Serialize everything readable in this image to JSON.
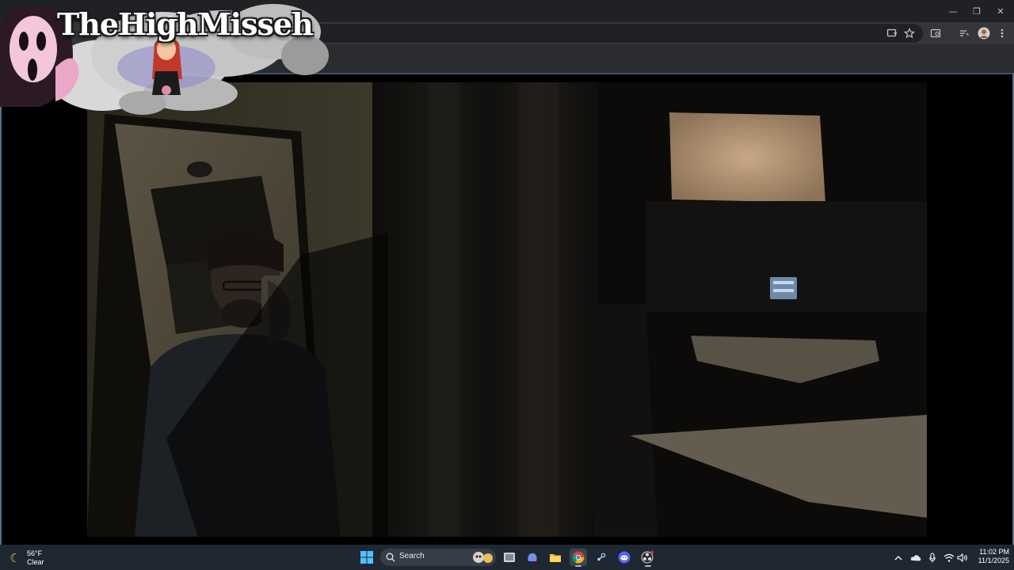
{
  "window_controls": {
    "minimize": "—",
    "maximize": "❐",
    "close": "✕"
  },
  "toolbar_icons": [
    "install-icon",
    "star-icon",
    "reading-mode-icon",
    "tab-search-icon",
    "profile-avatar",
    "more-menu-icon"
  ],
  "overlay": {
    "title": "TheHighMisseh"
  },
  "colors": {
    "titlebar": "#202124",
    "toolbar": "#35363a",
    "taskbar": "#1f2733",
    "accent": "#9fb8e0"
  },
  "taskbar": {
    "weather": {
      "temp": "56°F",
      "condition": "Clear"
    },
    "search_label": "Search",
    "apps": [
      "windows-start",
      "search",
      "task-view",
      "copilot",
      "file-explorer",
      "chrome",
      "steam",
      "discord",
      "obs"
    ],
    "tray": [
      "chevron-up-icon",
      "onedrive-icon",
      "microphone-icon",
      "wifi-icon",
      "speaker-icon"
    ],
    "clock": {
      "time": "11:02 PM",
      "date": "11/1/2025"
    }
  }
}
